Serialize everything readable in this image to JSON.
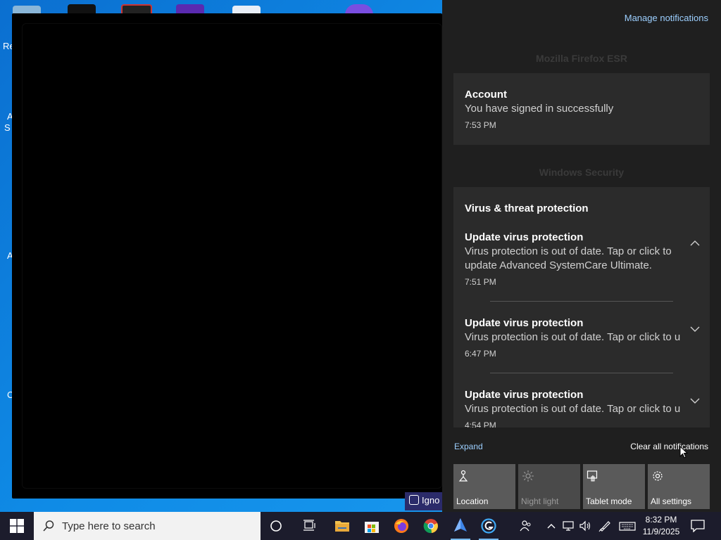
{
  "desktop": {
    "icon_labels": [
      "Re",
      "A",
      "S",
      "A",
      "C"
    ],
    "ignore_label": "Igno"
  },
  "action_center": {
    "manage_notifications": "Manage notifications",
    "groups": [
      {
        "app": "Mozilla Firefox ESR",
        "notifications": [
          {
            "title": "Account",
            "body": "You have signed in successfully",
            "time": "7:53 PM"
          }
        ]
      },
      {
        "app": "Windows Security",
        "heading": "Virus & threat protection",
        "notifications": [
          {
            "title": "Update virus protection",
            "body": "Virus protection is out of date. Tap or click to update Advanced SystemCare Ultimate.",
            "time": "7:51 PM",
            "expanded": true
          },
          {
            "title": "Update virus protection",
            "body": "Virus protection is out of date. Tap or click to u",
            "time": "6:47 PM",
            "expanded": false
          },
          {
            "title": "Update virus protection",
            "body": "Virus protection is out of date. Tap or click to u",
            "time": "4:54 PM",
            "expanded": false
          }
        ]
      }
    ],
    "expand_label": "Expand",
    "clear_label": "Clear all notifications",
    "quick_actions": [
      {
        "label": "Location",
        "icon": "location-icon",
        "enabled": true
      },
      {
        "label": "Night light",
        "icon": "night-light-icon",
        "enabled": false
      },
      {
        "label": "Tablet mode",
        "icon": "tablet-mode-icon",
        "enabled": true
      },
      {
        "label": "All settings",
        "icon": "gear-icon",
        "enabled": true
      }
    ]
  },
  "taskbar": {
    "search_placeholder": "Type here to search",
    "apps": [
      "cortana-icon",
      "task-view-icon",
      "file-explorer-icon",
      "microsoft-store-icon",
      "firefox-icon",
      "chrome-icon",
      "app-icon",
      "advanced-systemcare-icon"
    ],
    "time": "8:32 PM",
    "date": "11/9/2025"
  },
  "colors": {
    "action_center_bg": "#1f1f1f",
    "card_bg": "#2b2b2b",
    "link": "#9ccfff",
    "taskbar_bg": "#1c1c2c"
  }
}
